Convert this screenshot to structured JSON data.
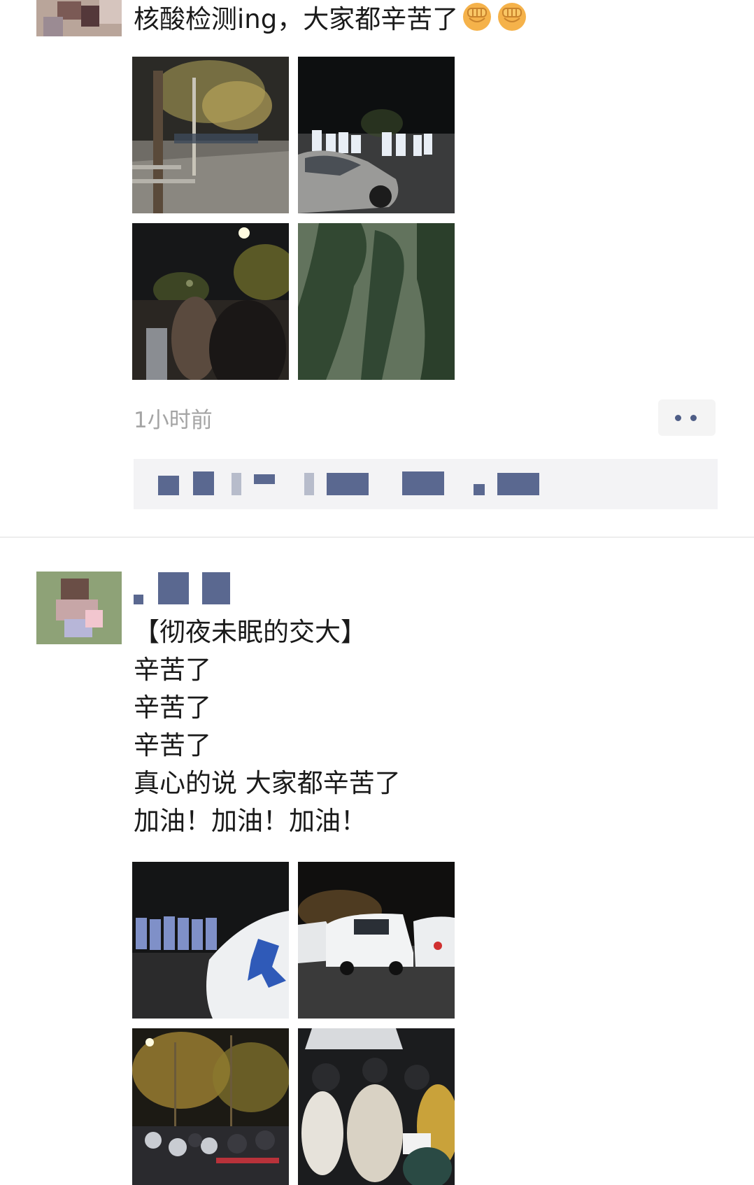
{
  "feed": {
    "posts": [
      {
        "author": "",
        "text": [
          "核酸检测ing，大家都辛苦了"
        ],
        "emoji": [
          "fist-emoji",
          "fist-emoji"
        ],
        "photos": [
          "photo-1",
          "photo-2",
          "photo-3",
          "photo-4"
        ],
        "time": "1小时前",
        "more_icon": "more-dots-icon"
      },
      {
        "author": "",
        "text": [
          "【彻夜未眠的交大】",
          "辛苦了",
          "辛苦了",
          "辛苦了",
          "真心的说 大家都辛苦了",
          "加油！加油！加油！"
        ],
        "photos": [
          "photo-5",
          "photo-6",
          "photo-7",
          "photo-8"
        ]
      }
    ]
  },
  "colors": {
    "link": "#5a6890",
    "time": "#a4a4a4",
    "comment_bg": "#f3f3f5"
  }
}
